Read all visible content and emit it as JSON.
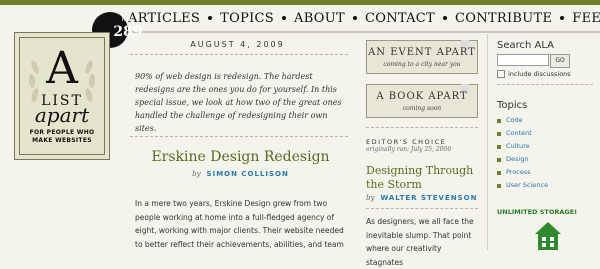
{
  "nav": {
    "items": [
      "ARTICLES",
      "TOPICS",
      "ABOUT",
      "CONTACT",
      "CONTRIBUTE",
      "FEED"
    ]
  },
  "issue": {
    "label": "No.",
    "number": "289"
  },
  "logo": {
    "a": "A",
    "list": "LIST",
    "apart": "apart",
    "tagline": "FOR PEOPLE WHO MAKE WEBSITES"
  },
  "main": {
    "date": "AUGUST 4, 2009",
    "intro": "90% of web design is redesign. The hardest redesigns are the ones you do for yourself. In this special issue, we look at how two of the great ones handled the challenge of redesigning their own sites.",
    "article": {
      "title": "Erskine Design Redesign",
      "by": "by",
      "author": "SIMON COLLISON",
      "body": "In a mere two years, Erskine Design grew from two people working at home into a full-fledged agency of eight, working with major clients. Their website needed to better reflect their achievements, abilities, and team"
    }
  },
  "ads": [
    {
      "title": "AN EVENT APART",
      "subtitle": "coming to a city near you"
    },
    {
      "title": "A BOOK APART",
      "subtitle": "coming soon"
    }
  ],
  "editors_choice": {
    "label": "EDITOR'S CHOICE",
    "sub": "originally ran: July 25, 2006",
    "title": "Designing Through the Storm",
    "by": "by",
    "author": "WALTER STEVENSON",
    "body": "As designers, we all face the inevitable slump. That point where our creativity stagnates"
  },
  "sidebar": {
    "search_title": "Search ALA",
    "search_value": "",
    "go_label": "GO",
    "include_label": "include discussions",
    "topics_title": "Topics",
    "topics": [
      "Code",
      "Content",
      "Culture",
      "Design",
      "Process",
      "User Science"
    ],
    "promo": "UNLIMITED STORAGE!"
  }
}
